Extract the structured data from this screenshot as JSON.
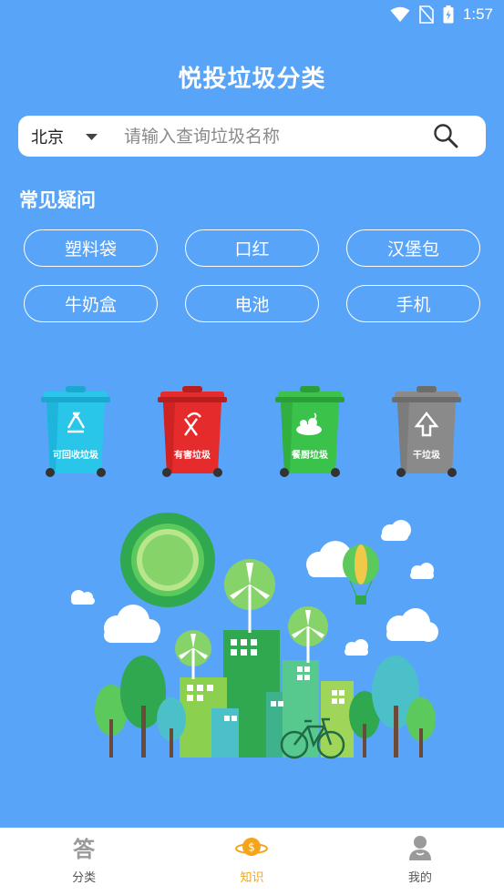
{
  "status_bar": {
    "time": "1:57",
    "icons": [
      "wifi-icon",
      "no-sim-icon",
      "battery-charging-icon"
    ]
  },
  "app_title": "悦投垃圾分类",
  "search": {
    "city": "北京",
    "placeholder": "请输入查询垃圾名称",
    "value": ""
  },
  "common_questions": {
    "title": "常见疑问",
    "items": [
      "塑料袋",
      "口红",
      "汉堡包",
      "牛奶盒",
      "电池",
      "手机"
    ]
  },
  "bins": [
    {
      "label": "可回收垃圾",
      "color": "#29c6ea",
      "icon": "recycle-icon"
    },
    {
      "label": "有害垃圾",
      "color": "#e52b2b",
      "icon": "hazard-icon"
    },
    {
      "label": "餐厨垃圾",
      "color": "#3ac24a",
      "icon": "food-waste-icon"
    },
    {
      "label": "干垃圾",
      "color": "#8a8a8a",
      "icon": "dry-waste-icon"
    }
  ],
  "bottom_nav": {
    "items": [
      {
        "label": "分类",
        "icon": "answer-icon",
        "glyph": "答"
      },
      {
        "label": "知识",
        "icon": "coin-planet-icon"
      },
      {
        "label": "我的",
        "icon": "user-icon"
      }
    ],
    "active_index": 1
  },
  "colors": {
    "background": "#58a4f8",
    "accent": "#f4a51c",
    "nav_inactive": "#9a9a9a"
  }
}
